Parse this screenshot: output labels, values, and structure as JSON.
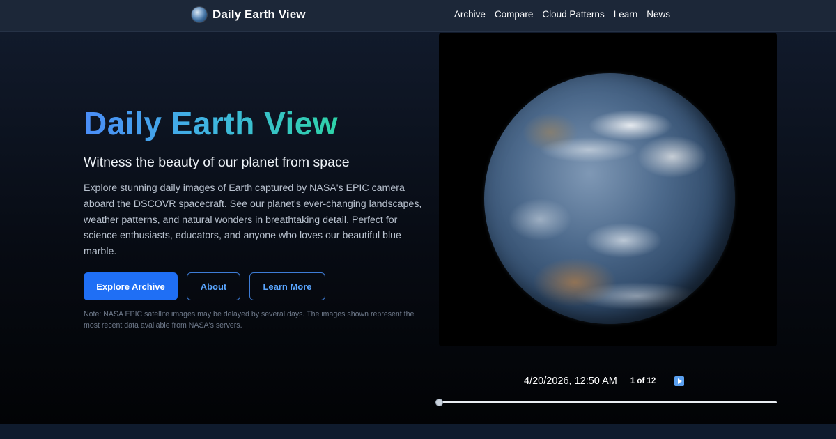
{
  "brand": {
    "name": "Daily Earth View",
    "logo_icon": "earth-globe-icon"
  },
  "nav": {
    "items": [
      {
        "label": "Archive"
      },
      {
        "label": "Compare"
      },
      {
        "label": "Cloud Patterns"
      },
      {
        "label": "Learn"
      },
      {
        "label": "News"
      }
    ]
  },
  "hero": {
    "title": "Daily Earth View",
    "subtitle": "Witness the beauty of our planet from space",
    "description": "Explore stunning daily images of Earth captured by NASA's EPIC camera aboard the DSCOVR spacecraft. See our planet's ever-changing landscapes, weather patterns, and natural wonders in breathtaking detail. Perfect for science enthusiasts, educators, and anyone who loves our beautiful blue marble.",
    "buttons": {
      "primary": "Explore Archive",
      "about": "About",
      "learn_more": "Learn More"
    },
    "note": "Note: NASA EPIC satellite images may be delayed by several days. The images shown represent the most recent data available from NASA's servers."
  },
  "viewer": {
    "timestamp": "4/20/2026, 12:50 AM",
    "counter": "1 of 12",
    "play_icon": "play-icon",
    "slider_value": 0
  },
  "colors": {
    "accent": "#1f6ff5",
    "outline": "#3d7cd6",
    "title_gradient_start": "#4b8df8",
    "title_gradient_end": "#2ed3a8",
    "nav_bg": "#1c2738"
  }
}
